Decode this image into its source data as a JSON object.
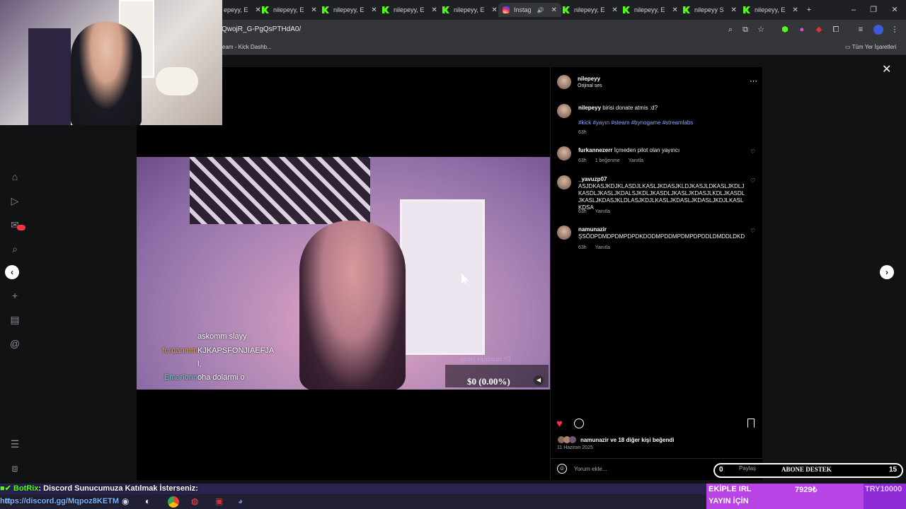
{
  "browser": {
    "tabs": [
      {
        "label": "nilepeyy, E",
        "type": "kick"
      },
      {
        "label": "nilepeyy, E",
        "type": "kick"
      },
      {
        "label": "nilepeyy, E",
        "type": "kick"
      },
      {
        "label": "nilepeyy, E",
        "type": "kick"
      },
      {
        "label": "Instag",
        "type": "instagram",
        "active": true
      },
      {
        "label": "nilepeyy, E",
        "type": "kick"
      },
      {
        "label": "nilepeyy, E",
        "type": "kick"
      },
      {
        "label": "nilepeyy S",
        "type": "kick"
      },
      {
        "label": "nilepeyy, E",
        "type": "kick"
      }
    ],
    "first_tab_label": "epeyy, E",
    "url": "QwojR_G-PgQsPTHdA0/",
    "bookmark_left": "eam - Kick Dashb...",
    "bookmark_right": "Tüm Yer İşaretleri"
  },
  "post": {
    "author": "nilepeyy",
    "audio": "Orijinal ses",
    "caption_user": "nilepeyy",
    "caption_text": "birisi donate atmis :d?",
    "hashtags": "#kick #yayın #steam #bynogame #streamlabs",
    "caption_time": "63h",
    "comments": [
      {
        "user": "furkannezerr",
        "text": "İçmeden pilot olan yayıncı",
        "time": "63h",
        "likes": "1 beğenme",
        "reply": "Yanıtla"
      },
      {
        "user": "_yavuzp07",
        "text": "ASJDKASJKDJKLASDJLKASLJKDASJKLDJKASJLDKASLJKDLJKASDLJKASLJKDALSJKDLJKASDLJKASLJKDASJLKDLJKASDLJKASLJKDASJKLDLASJKDJLKASLJKDASLJKDASLJKDJLKASLKDSA",
        "time": "63h",
        "likes": "",
        "reply": "Yanıtla"
      },
      {
        "user": "namunazir",
        "text": "ŞSÖDPDMDPDMPDPDKDODMPDDMPDMPDPDDLDMDDLDKD",
        "time": "63h",
        "likes": "",
        "reply": "Yanıtla"
      }
    ],
    "liked_by": "namunazir ve 18 diğer kişi beğendi",
    "date": "11 Haziran 2025",
    "comment_placeholder": "Yorum ekle..."
  },
  "video_overlay": {
    "chat": [
      {
        "user": "",
        "msg": "askomm slayy"
      },
      {
        "user": "furqanmm",
        "msg": "KJKAPSFONJIAEFJA"
      },
      {
        "user": "",
        "msg": "l,"
      },
      {
        "user": "Emarionn",
        "msg": "oha dolarmi o"
      }
    ],
    "donation": "$0 (0.00%)",
    "signature": "genel ekipman <3"
  },
  "stream_overlay": {
    "ticker_bot": "BotRix",
    "ticker_text": ": Discord Sunucumuza Katılmak İsterseniz:",
    "ticker_link": "https://discord.gg/Mqpoz8KETM",
    "donation_left": "0",
    "share": "Paylaş",
    "abone": "ABONE DESTEK",
    "donation_right": "15",
    "ekiple_line1": "EKİPLE IRL",
    "ekiple_line2": "YAYIN İÇİN",
    "ekiple_amount": "7929₺",
    "ekiple_goal": "TRY10000"
  },
  "colors": {
    "kick_green": "#53fc18",
    "heart_red": "#ff3040",
    "hashtag_blue": "#8fa8ff",
    "ekiple_purple": "#8e2bd4"
  }
}
